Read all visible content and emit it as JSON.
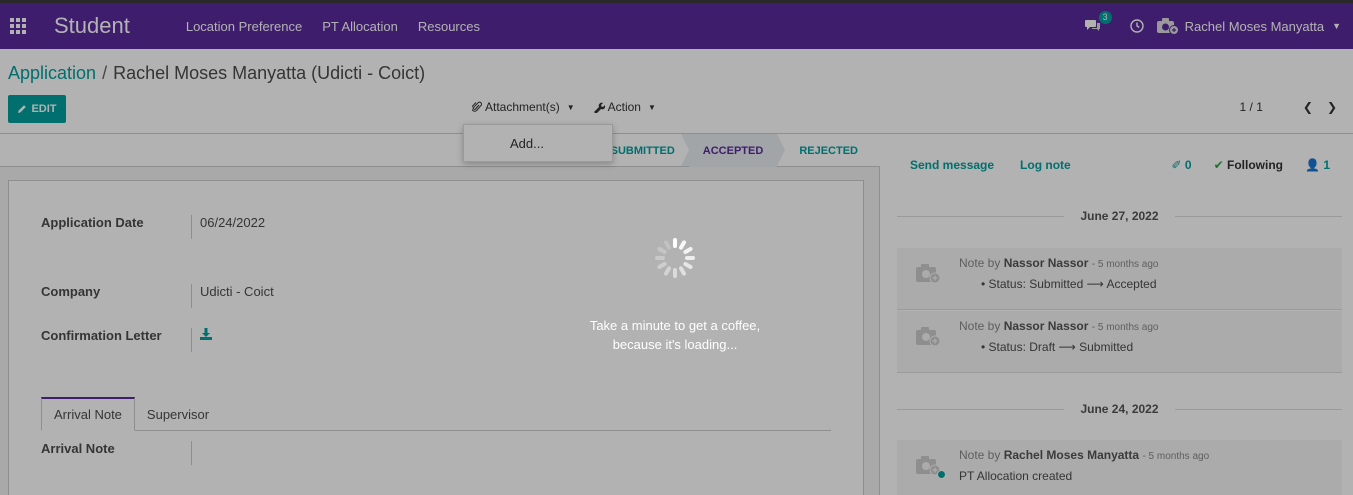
{
  "topbar": {
    "brand": "Student",
    "menu": [
      "Location Preference",
      "PT Allocation",
      "Resources"
    ],
    "chat_count": "3",
    "user_name": "Rachel Moses Manyatta"
  },
  "control_panel": {
    "breadcrumb_link": "Application",
    "breadcrumb_sep": "/",
    "breadcrumb_current": "Rachel Moses Manyatta (Udicti - Coict)",
    "edit_label": "EDIT",
    "attachments_label": "Attachment(s)",
    "action_label": "Action",
    "pager_value": "1 / 1",
    "dropdown_item": "Add..."
  },
  "statusbar": {
    "stages": [
      "SUBMITTED",
      "ACCEPTED",
      "REJECTED"
    ],
    "active_stage": "ACCEPTED"
  },
  "form": {
    "application_date_label": "Application Date",
    "application_date_value": "06/24/2022",
    "company_label": "Company",
    "company_value": "Udicti - Coict",
    "confirmation_letter_label": "Confirmation Letter",
    "tabs": [
      "Arrival Note",
      "Supervisor"
    ],
    "arrival_note_label": "Arrival Note"
  },
  "chatter": {
    "send_message": "Send message",
    "log_note": "Log note",
    "attachment_count": "0",
    "following": "Following",
    "follower_count": "1",
    "dates": [
      "June 27, 2022",
      "June 24, 2022"
    ],
    "messages": [
      {
        "prefix": "Note by",
        "author": "Nassor Nassor",
        "ago": "- 5 months ago",
        "body": "Status: Submitted ⟶ Accepted"
      },
      {
        "prefix": "Note by",
        "author": "Nassor Nassor",
        "ago": "- 5 months ago",
        "body": "Status: Draft ⟶ Submitted"
      },
      {
        "prefix": "Note by",
        "author": "Rachel Moses Manyatta",
        "ago": "- 5 months ago",
        "body": "PT Allocation created"
      }
    ]
  },
  "loading": {
    "line1": "Take a minute to get a coffee,",
    "line2": "because it's loading..."
  },
  "colors": {
    "brand": "#5a2a9c",
    "accent": "#00a09d"
  }
}
